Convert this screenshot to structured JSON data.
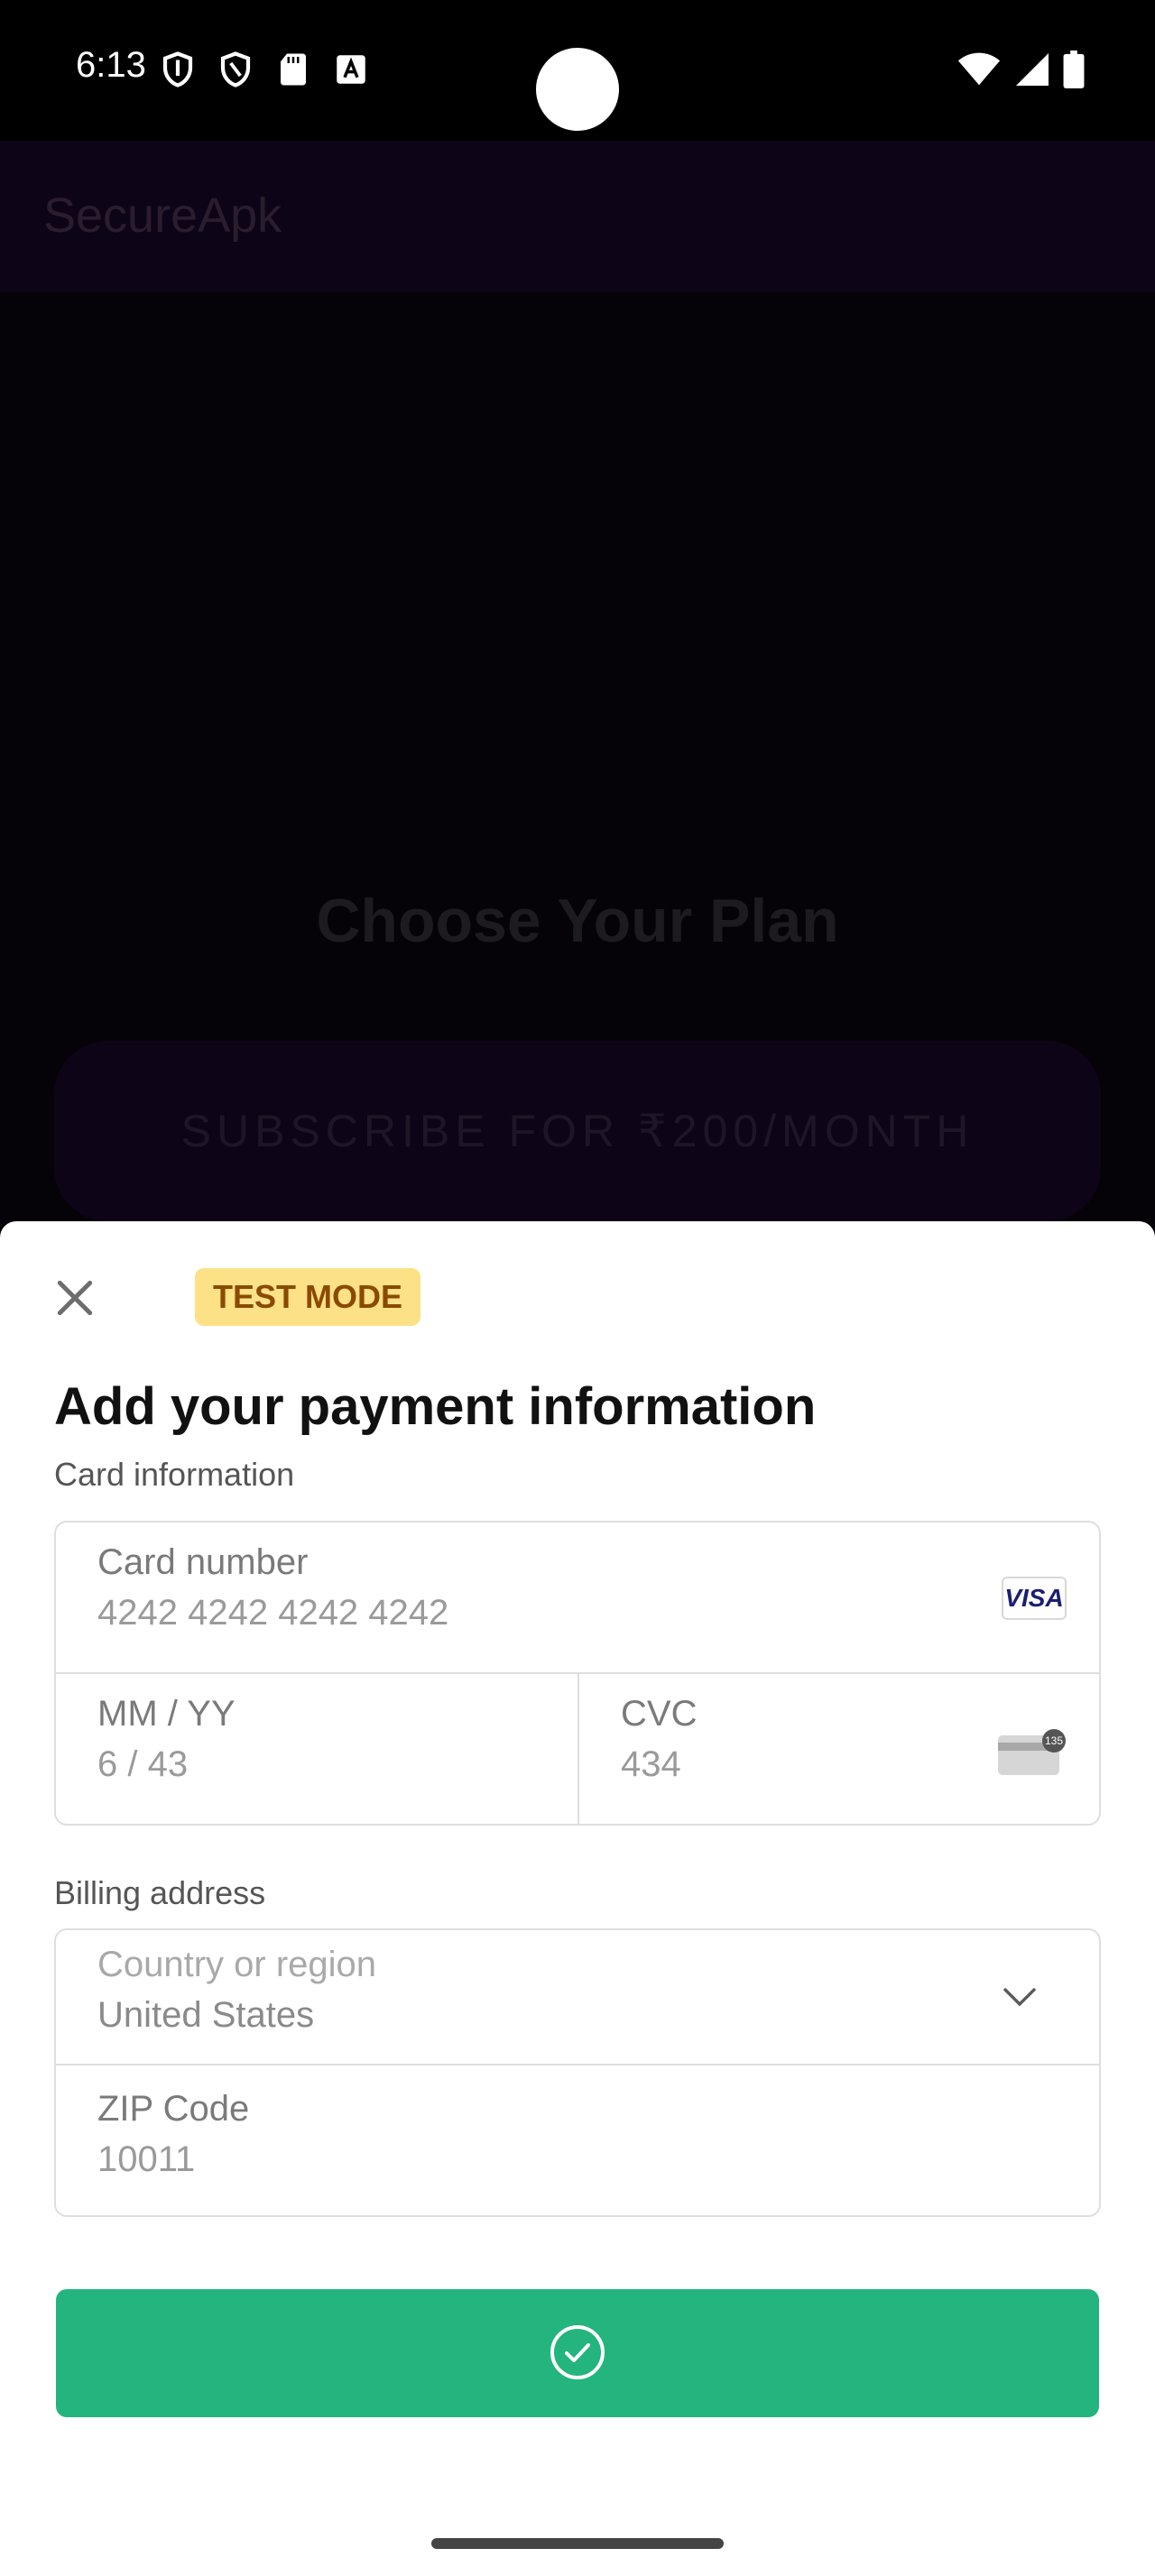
{
  "status_bar": {
    "time": "6:13",
    "left_icons": [
      "shield-icon",
      "shield-outline-icon",
      "sd-card-icon",
      "text-a-icon"
    ],
    "right_icons": [
      "wifi-icon",
      "signal-icon",
      "battery-icon"
    ]
  },
  "app": {
    "title": "SecureApk",
    "heading": "Choose Your Plan",
    "subscribe_button": "SUBSCRIBE FOR ₹200/MONTH"
  },
  "sheet": {
    "close_icon": "close-icon",
    "badge": "TEST MODE",
    "title": "Add your payment information",
    "card_section_label": "Card information",
    "card_number": {
      "label": "Card number",
      "value": "4242 4242 4242 4242",
      "brand": "VISA"
    },
    "expiry": {
      "label": "MM / YY",
      "value": "6 / 43"
    },
    "cvc": {
      "label": "CVC",
      "value": "434",
      "icon_badge": "135"
    },
    "billing_section_label": "Billing address",
    "country": {
      "label": "Country or region",
      "value": "United States"
    },
    "zip": {
      "label": "ZIP Code",
      "value": "10011"
    },
    "submit_icon": "check-circle-icon"
  },
  "colors": {
    "accent_green": "#24b47e",
    "badge_bg": "#fde187",
    "badge_text": "#8a4a00"
  }
}
